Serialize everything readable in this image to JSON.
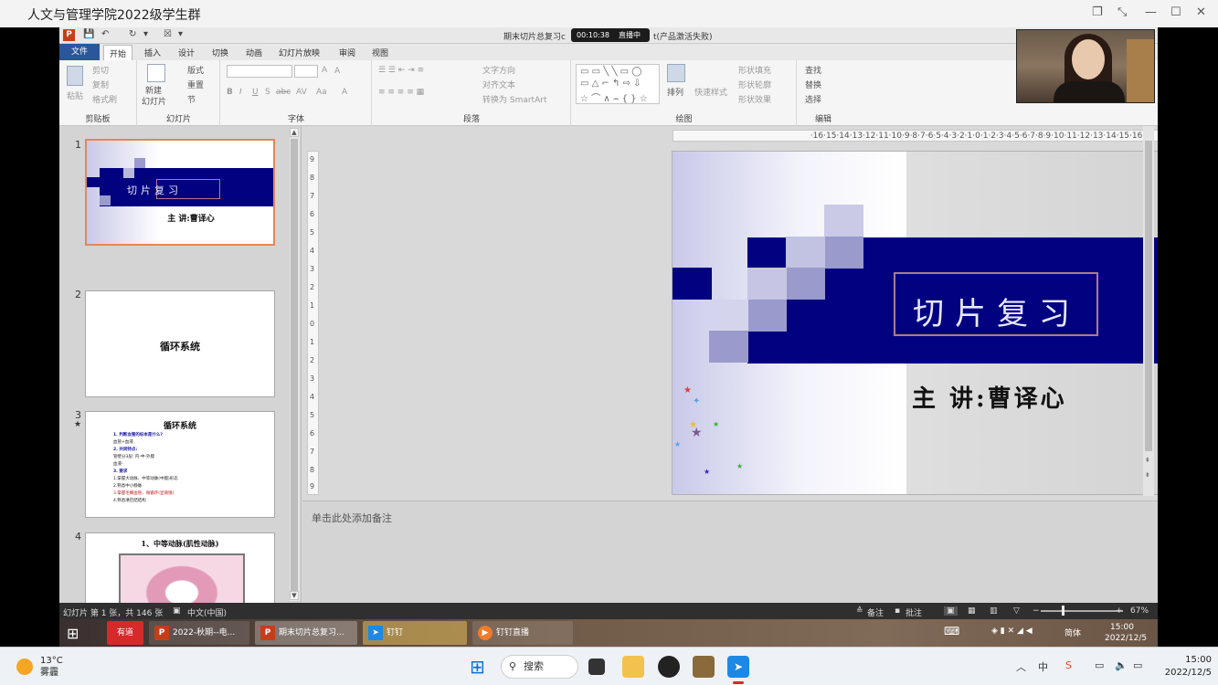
{
  "window": {
    "title": "人文与管理学院2022级学生群"
  },
  "ppt": {
    "doc_title": "期末切片总复习.ppt [兼容模式] - Microsoft PowerPoint(产品激活失败)",
    "doc_title_left": "期末切片总复习c",
    "doc_title_right": "t(产品激活失败)",
    "live_timer": "00:10:38",
    "live_label": "直播中",
    "tabs": [
      "文件",
      "开始",
      "插入",
      "设计",
      "切换",
      "动画",
      "幻灯片放映",
      "审阅",
      "视图"
    ],
    "ribbon": {
      "clipboard": {
        "group": "剪贴板",
        "paste": "粘贴",
        "cut": "剪切",
        "copy": "复制",
        "format_painter": "格式刷"
      },
      "slides": {
        "group": "幻灯片",
        "new_slide": "新建\n幻灯片",
        "new_slide_1": "新建",
        "new_slide_2": "幻灯片",
        "layout": "版式",
        "reset": "重置",
        "section": "节"
      },
      "font": {
        "group": "字体",
        "bold": "B",
        "italic": "I",
        "underline": "U",
        "shadow": "S",
        "strike": "abc",
        "spacing": "AV",
        "case": "Aa",
        "color": "A",
        "grow": "A",
        "shrink": "A"
      },
      "paragraph": {
        "group": "段落",
        "text_direction": "文字方向",
        "align_text": "对齐文本",
        "smartart": "转换为 SmartArt"
      },
      "drawing": {
        "group": "绘图",
        "arrange": "排列",
        "quick_styles": "快速样式",
        "fill": "形状填充",
        "outline": "形状轮廓",
        "effects": "形状效果"
      },
      "editing": {
        "group": "编辑",
        "find": "查找",
        "replace": "替换",
        "select": "选择"
      }
    },
    "ruler_h": "·16·15·14·13·12·11·10·9·8·7·6·5·4·3·2·1·0·1·2·3·4·5·6·7·8·9·10·11·12·13·14·15·16·",
    "ruler_v": [
      "9",
      "8",
      "7",
      "6",
      "5",
      "4",
      "3",
      "2",
      "1",
      "0",
      "1",
      "2",
      "3",
      "4",
      "5",
      "6",
      "7",
      "8",
      "9"
    ],
    "thumbnails": [
      {
        "num": "1",
        "title": "切片复习",
        "subtitle": "主 讲:曹译心"
      },
      {
        "num": "2",
        "title": "循环系统"
      },
      {
        "num": "3",
        "star": "★",
        "title": "循环系统",
        "lines": [
          "1. 判断血管的标本是什么?",
          "血管+血液",
          "2. 共同特点:",
          "管壁分3层: 内-中-外膜",
          "血液-",
          "3. 要求",
          "1.掌握大动脉、中等动脉(中膜)形态",
          "2.熟悉中小静脉",
          "3.掌握毛细血管、微循环(显微镜)",
          "4.熟悉淋巴结结构"
        ]
      },
      {
        "num": "4",
        "title": "1、中等动脉(肌性动脉)"
      }
    ],
    "slide": {
      "title": "切片复习",
      "subtitle": "主 讲:曹译心"
    },
    "notes_placeholder": "单击此处添加备注",
    "status": {
      "slide_count": "幻灯片 第 1 张，共 146 张",
      "language": "中文(中国)",
      "notes": "备注",
      "comments": "批注",
      "zoom": "67%",
      "minus": "−",
      "plus": "+"
    }
  },
  "remote_taskbar": {
    "apps": [
      "有道",
      "2022-秋期--电...",
      "期末切片总复习...",
      "钉钉",
      "钉钉直播"
    ],
    "ime": "简体",
    "time": "15:00",
    "date": "2022/12/5"
  },
  "host_taskbar": {
    "weather_temp": "13°C",
    "weather_desc": "雾霾",
    "search": "搜索",
    "ime": "中",
    "time": "15:00",
    "date": "2022/12/5"
  },
  "colors": {
    "band": "#020280",
    "title_box": "#b07a8a",
    "pp_red": "#c43e1c",
    "file_tab": "#2b579a"
  }
}
